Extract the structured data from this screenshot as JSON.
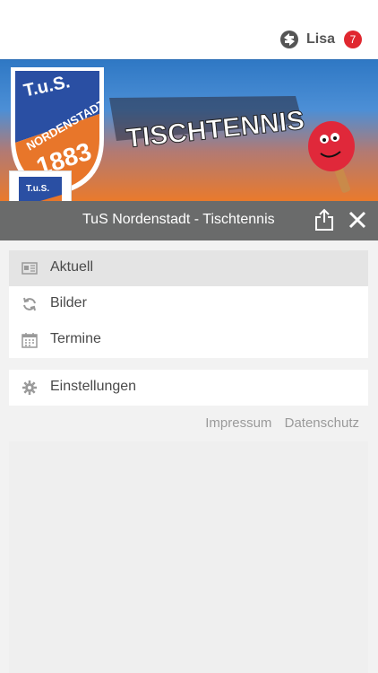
{
  "topbar": {
    "user_name": "Lisa",
    "notification_count": "7",
    "user_icon": "sync-person-icon"
  },
  "banner": {
    "logo_text_line1": "T.u.S.",
    "logo_text_line2": "NORDENSTADT",
    "logo_year": "1883",
    "headline": "TISCHTENNIS"
  },
  "titlebar": {
    "title": "TuS Nordenstadt - Tischtennis",
    "share_icon": "share-icon",
    "close_icon": "close-icon"
  },
  "menu": {
    "items": [
      {
        "label": "Aktuell",
        "icon": "newspaper-icon",
        "active": true
      },
      {
        "label": "Bilder",
        "icon": "refresh-icon",
        "active": false
      },
      {
        "label": "Termine",
        "icon": "calendar-icon",
        "active": false
      }
    ],
    "settings": {
      "label": "Einstellungen",
      "icon": "gear-icon"
    }
  },
  "footer_links": {
    "impressum": "Impressum",
    "datenschutz": "Datenschutz"
  },
  "colors": {
    "badge": "#e0272f",
    "titlebar": "#6a6b6b",
    "active_item": "#e4e4e4"
  }
}
